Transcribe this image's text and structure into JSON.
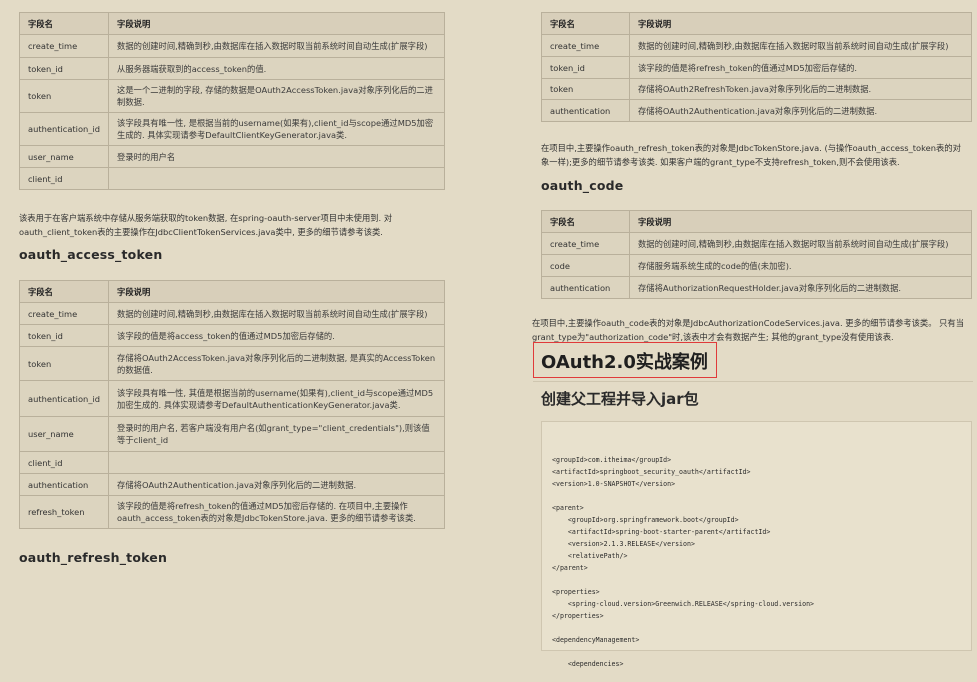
{
  "left": {
    "table1": {
      "headers": [
        "字段名",
        "字段说明"
      ],
      "rows": [
        [
          "create_time",
          "数据的创建时间,精确到秒,由数据库在插入数据时取当前系统时间自动生成(扩展字段)"
        ],
        [
          "token_id",
          "从服务器端获取到的access_token的值."
        ],
        [
          "token",
          "这是一个二进制的字段, 存储的数据是OAuth2AccessToken.java对象序列化后的二进制数据."
        ],
        [
          "authentication_id",
          "该字段具有唯一性, 是根据当前的username(如果有),client_id与scope通过MD5加密生成的. 具体实现请参考DefaultClientKeyGenerator.java类."
        ],
        [
          "user_name",
          "登录时的用户名"
        ],
        [
          "client_id",
          ""
        ]
      ]
    },
    "para1": "该表用于在客户端系统中存储从服务端获取的token数据, 在spring-oauth-server项目中未使用到. 对oauth_client_token表的主要操作在JdbcClientTokenServices.java类中, 更多的细节请参考该类.",
    "heading2": "oauth_access_token",
    "table2": {
      "headers": [
        "字段名",
        "字段说明"
      ],
      "rows": [
        [
          "create_time",
          "数据的创建时间,精确到秒,由数据库在插入数据时取当前系统时间自动生成(扩展字段)"
        ],
        [
          "token_id",
          "该字段的值是将access_token的值通过MD5加密后存储的."
        ],
        [
          "token",
          "存储将OAuth2AccessToken.java对象序列化后的二进制数据, 是真实的AccessToken的数据值."
        ],
        [
          "authentication_id",
          "该字段具有唯一性, 其值是根据当前的username(如果有),client_id与scope通过MD5加密生成的. 具体实现请参考DefaultAuthenticationKeyGenerator.java类."
        ],
        [
          "user_name",
          "登录时的用户名, 若客户端没有用户名(如grant_type=\"client_credentials\"),则该值等于client_id"
        ],
        [
          "client_id",
          ""
        ],
        [
          "authentication",
          "存储将OAuth2Authentication.java对象序列化后的二进制数据."
        ],
        [
          "refresh_token",
          "该字段的值是将refresh_token的值通过MD5加密后存储的. 在项目中,主要操作oauth_access_token表的对象是JdbcTokenStore.java. 更多的细节请参考该类."
        ]
      ]
    },
    "heading3": "oauth_refresh_token"
  },
  "right": {
    "table1": {
      "headers": [
        "字段名",
        "字段说明"
      ],
      "rows": [
        [
          "create_time",
          "数据的创建时间,精确到秒,由数据库在插入数据时取当前系统时间自动生成(扩展字段)"
        ],
        [
          "token_id",
          "该字段的值是将refresh_token的值通过MD5加密后存储的."
        ],
        [
          "token",
          "存储将OAuth2RefreshToken.java对象序列化后的二进制数据."
        ],
        [
          "authentication",
          "存储将OAuth2Authentication.java对象序列化后的二进制数据."
        ]
      ]
    },
    "para1": "在项目中,主要操作oauth_refresh_token表的对象是JdbcTokenStore.java. (与操作oauth_access_token表的对象一样);更多的细节请参考该类. 如果客户端的grant_type不支持refresh_token,则不会使用该表.",
    "heading_code": "oauth_code",
    "table2": {
      "headers": [
        "字段名",
        "字段说明"
      ],
      "rows": [
        [
          "create_time",
          "数据的创建时间,精确到秒,由数据库在插入数据时取当前系统时间自动生成(扩展字段)"
        ],
        [
          "code",
          "存储服务端系统生成的code的值(未加密)."
        ],
        [
          "authentication",
          "存储将AuthorizationRequestHolder.java对象序列化后的二进制数据."
        ]
      ]
    },
    "para2": "在项目中,主要操作oauth_code表的对象是JdbcAuthorizationCodeServices.java. 更多的细节请参考该类。 只有当grant_type为\"authorization_code\"时,该表中才会有数据产生; 其他的grant_type没有使用该表.",
    "h1": "OAuth2.0实战案例",
    "h2": "创建父工程并导入jar包",
    "code_lines": [
      "<groupId>com.itheima</groupId>",
      "<artifactId>springboot_security_oauth</artifactId>",
      "<version>1.0-SNAPSHOT</version>",
      "",
      "<parent>",
      "    <groupId>org.springframework.boot</groupId>",
      "    <artifactId>spring-boot-starter-parent</artifactId>",
      "    <version>2.1.3.RELEASE</version>",
      "    <relativePath/>",
      "</parent>",
      "",
      "<properties>",
      "    <spring-cloud.version>Greenwich.RELEASE</spring-cloud.version>",
      "</properties>",
      "",
      "<dependencyManagement>",
      "",
      "    <dependencies>"
    ]
  }
}
